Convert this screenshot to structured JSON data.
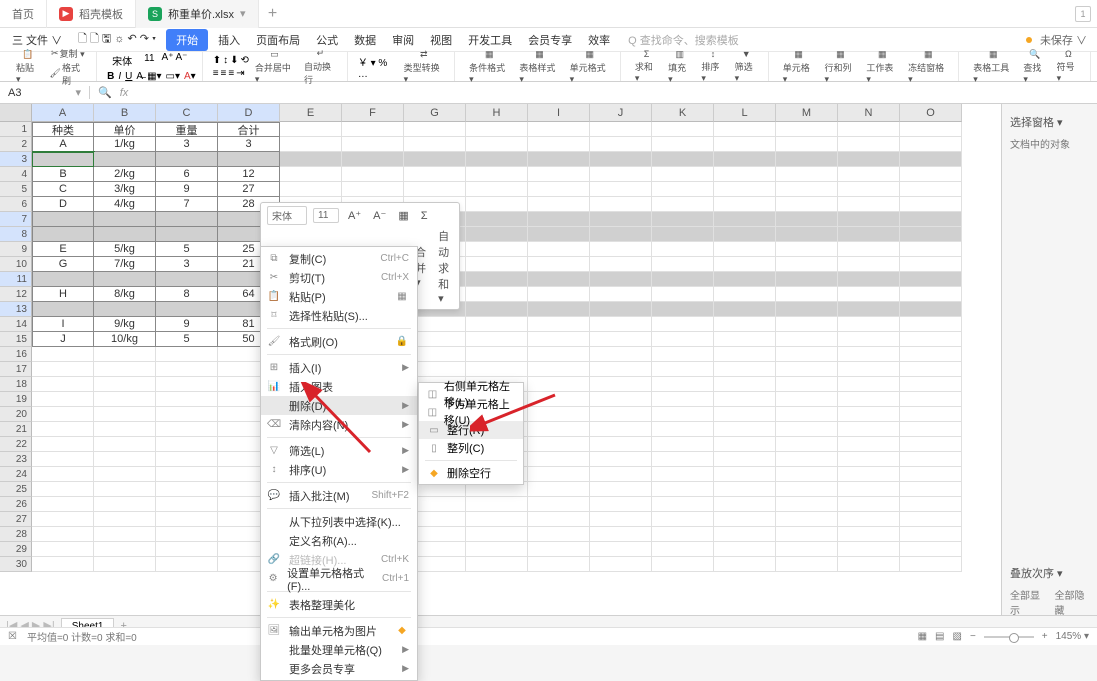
{
  "tabs": {
    "home": "首页",
    "template": "稻壳模板",
    "file": "称重单价.xlsx",
    "add": "+"
  },
  "top_right": "1",
  "menu": {
    "file": "三 文件 ∨",
    "items": [
      "开始",
      "插入",
      "页面布局",
      "公式",
      "数据",
      "审阅",
      "视图",
      "开发工具",
      "会员专享",
      "效率"
    ],
    "search_hint": "Q 查找命令、搜索模板",
    "notify": "未保存 ∨"
  },
  "ribbon": {
    "paste": "粘贴 ▾",
    "copy": "复制 ▾",
    "fmt": "格式刷",
    "font_name": "宋体",
    "font_size": "11",
    "merge": "合并居中 ▾",
    "wrap": "自动换行",
    "currency_label": "￥ ▾ % …",
    "num_fmt": "类型转换 ▾",
    "cfmt": "条件格式 ▾",
    "tstyle": "表格样式 ▾",
    "cstyle": "单元格式 ▾",
    "sum": "求和 ▾",
    "fill": "填充 ▾",
    "sort": "排序 ▾",
    "filter": "筛选 ▾",
    "cell": "单元格 ▾",
    "rowcol": "行和列 ▾",
    "sheet": "工作表 ▾",
    "freeze": "冻结窗格 ▾",
    "tools": "表格工具 ▾",
    "find": "查找 ▾",
    "symbol": "符号 ▾"
  },
  "name_box": "A3",
  "fx": "fx",
  "columns": [
    "A",
    "B",
    "C",
    "D",
    "E",
    "F",
    "G",
    "H",
    "I",
    "J",
    "K",
    "L",
    "M",
    "N",
    "O"
  ],
  "headers": {
    "c1": "种类",
    "c2": "单价",
    "c3": "重量",
    "c4": "合计"
  },
  "rows": [
    {
      "n": 1,
      "a": "种类",
      "b": "单价",
      "c": "重量",
      "d": "合计",
      "head": true
    },
    {
      "n": 2,
      "a": "A",
      "b": "1/kg",
      "c": "3",
      "d": "3"
    },
    {
      "n": 3,
      "a": "",
      "b": "",
      "c": "",
      "d": "",
      "sel": true,
      "cursor": true
    },
    {
      "n": 4,
      "a": "B",
      "b": "2/kg",
      "c": "6",
      "d": "12"
    },
    {
      "n": 5,
      "a": "C",
      "b": "3/kg",
      "c": "9",
      "d": "27"
    },
    {
      "n": 6,
      "a": "D",
      "b": "4/kg",
      "c": "7",
      "d": "28"
    },
    {
      "n": 7,
      "a": "",
      "b": "",
      "c": "",
      "d": "",
      "sel": true
    },
    {
      "n": 8,
      "a": "",
      "b": "",
      "c": "",
      "d": "",
      "sel": true
    },
    {
      "n": 9,
      "a": "E",
      "b": "5/kg",
      "c": "5",
      "d": "25"
    },
    {
      "n": 10,
      "a": "G",
      "b": "7/kg",
      "c": "3",
      "d": "21"
    },
    {
      "n": 11,
      "a": "",
      "b": "",
      "c": "",
      "d": "",
      "sel": true
    },
    {
      "n": 12,
      "a": "H",
      "b": "8/kg",
      "c": "8",
      "d": "64"
    },
    {
      "n": 13,
      "a": "",
      "b": "",
      "c": "",
      "d": "",
      "sel": true
    },
    {
      "n": 14,
      "a": "I",
      "b": "9/kg",
      "c": "9",
      "d": "81"
    },
    {
      "n": 15,
      "a": "J",
      "b": "10/kg",
      "c": "5",
      "d": "50"
    }
  ],
  "extra_rows": [
    16,
    17,
    18,
    19,
    20,
    21,
    22,
    23,
    24,
    25,
    26,
    27,
    28,
    29,
    30
  ],
  "mini": {
    "font": "宋体",
    "size": "11",
    "merge": "合并 ▾",
    "autosum": "自动求和 ▾"
  },
  "ctx": {
    "copy": "复制(C)",
    "copy_k": "Ctrl+C",
    "cut": "剪切(T)",
    "cut_k": "Ctrl+X",
    "paste": "粘贴(P)",
    "paste_special": "选择性粘贴(S)...",
    "fmt_paint": "格式刷(O)",
    "insert": "插入(I)",
    "insert_chart": "插入图表",
    "delete": "删除(D)",
    "clear": "清除内容(N)",
    "filter": "筛选(L)",
    "sort": "排序(U)",
    "comment": "插入批注(M)",
    "comment_k": "Shift+F2",
    "dropdown": "从下拉列表中选择(K)...",
    "define_name": "定义名称(A)...",
    "hyperlink": "超链接(H)...",
    "hyperlink_k": "Ctrl+K",
    "cell_fmt": "设置单元格格式(F)...",
    "cell_fmt_k": "Ctrl+1",
    "beautify": "表格整理美化",
    "export_img": "输出单元格为图片",
    "batch": "批量处理单元格(Q)",
    "more": "更多会员专享"
  },
  "sub": {
    "shift_left": "右侧单元格左移(L)",
    "shift_up": "下方单元格上移(U)",
    "entire_row": "整行(R)",
    "entire_col": "整列(C)",
    "del_blank": "删除空行"
  },
  "right_panel": {
    "select": "选择窗格 ▾",
    "msg": "文档中的对象",
    "stack": "叠放次序 ▾",
    "show_all": "全部显示",
    "hide_all": "全部隐藏"
  },
  "sheet_tabs": {
    "name": "Sheet1"
  },
  "status": {
    "left": "平均值=0  计数=0  求和=0",
    "zoom": "145%  ▾"
  }
}
